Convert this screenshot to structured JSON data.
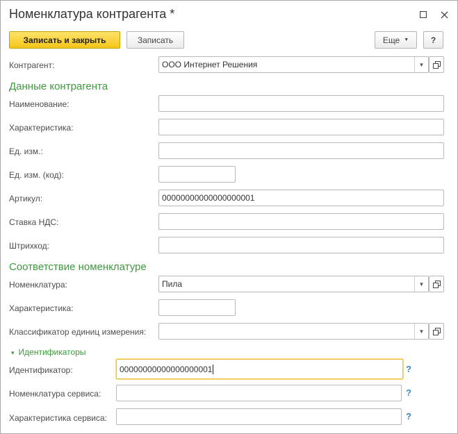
{
  "window": {
    "title": "Номенклатура контрагента *",
    "maximize_icon": "maximize-icon",
    "close_icon": "close-icon"
  },
  "toolbar": {
    "save_close_label": "Записать и закрыть",
    "save_label": "Записать",
    "more_label": "Еще",
    "help_label": "?"
  },
  "fields": {
    "counterparty": {
      "label": "Контрагент:",
      "value": "ООО Интернет Решения"
    },
    "section_counterparty": "Данные контрагента",
    "name": {
      "label": "Наименование:",
      "value": ""
    },
    "characteristic": {
      "label": "Характеристика:",
      "value": ""
    },
    "unit": {
      "label": "Ед. изм.:",
      "value": ""
    },
    "unit_code": {
      "label": "Ед. изм. (код):",
      "value": ""
    },
    "article": {
      "label": "Артикул:",
      "value": "00000000000000000001"
    },
    "vat_rate": {
      "label": "Ставка НДС:",
      "value": ""
    },
    "barcode": {
      "label": "Штрихкод:",
      "value": ""
    },
    "section_mapping": "Соответствие номенклатуре",
    "nomenclature": {
      "label": "Номенклатура:",
      "value": "Пила"
    },
    "nomenclature_characteristic": {
      "label": "Характеристика:",
      "value": ""
    },
    "unit_classifier": {
      "label": "Классификатор единиц измерения:",
      "value": ""
    },
    "identifiers_group": "Идентификаторы",
    "identifier": {
      "label": "Идентификатор:",
      "value": "00000000000000000001"
    },
    "service_nomenclature": {
      "label": "Номенклатура сервиса:",
      "value": ""
    },
    "service_characteristic": {
      "label": "Характеристика сервиса:",
      "value": ""
    },
    "help_mark": "?"
  }
}
